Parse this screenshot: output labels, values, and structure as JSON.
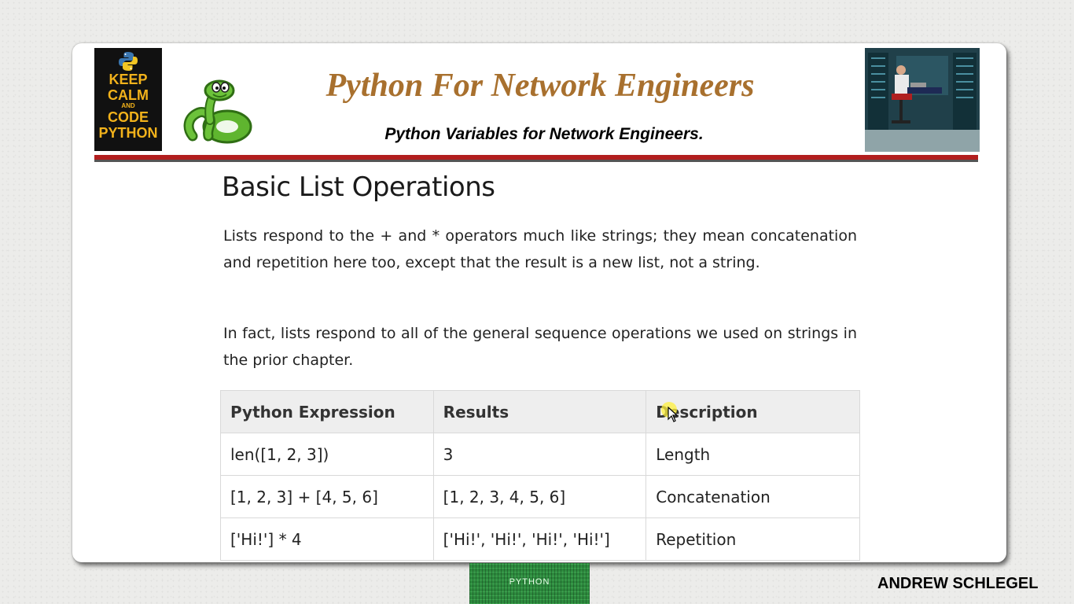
{
  "header": {
    "title": "Python For Network Engineers",
    "subtitle": "Python Variables for Network Engineers.",
    "keep_calm": {
      "line1": "KEEP",
      "line2": "CALM",
      "line3": "AND",
      "line4": "CODE",
      "line5": "PYTHON"
    }
  },
  "content": {
    "heading": "Basic List Operations",
    "paragraph1": "Lists respond to the + and * operators much like strings; they mean concatenation and repetition here too, except that the result is a new list, not a string.",
    "paragraph2": "In fact, lists respond to all of the general sequence operations we used on strings in the prior chapter.",
    "table": {
      "headers": [
        "Python Expression",
        "Results",
        "Description"
      ],
      "rows": [
        [
          "len([1, 2, 3])",
          "3",
          "Length"
        ],
        [
          "[1, 2, 3] + [4, 5, 6]",
          "[1, 2, 3, 4, 5, 6]",
          "Concatenation"
        ],
        [
          "['Hi!'] * 4",
          "['Hi!', 'Hi!', 'Hi!', 'Hi!']",
          "Repetition"
        ]
      ]
    }
  },
  "footer": {
    "book_label": "PYTHON",
    "author": "ANDREW SCHLEGEL"
  },
  "colors": {
    "title": "#a8702e",
    "red_bar": "#b21e1e",
    "keep_calm_bg": "#111111",
    "keep_calm_text": "#f2b21b"
  },
  "icons": [
    "python-logo-icon",
    "snake-mascot-icon",
    "mouse-cursor-icon"
  ]
}
